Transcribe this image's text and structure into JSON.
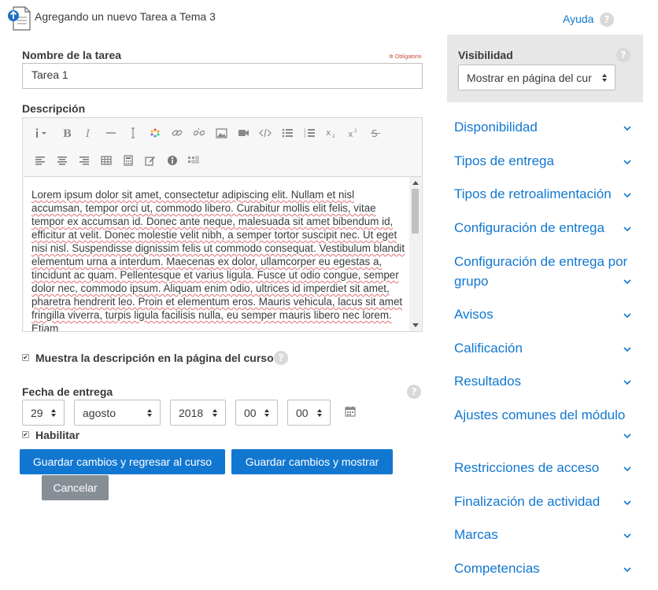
{
  "header": {
    "title": "Agregando un nuevo Tarea a Tema 3",
    "help_label": "Ayuda",
    "help_icon": "?"
  },
  "form": {
    "name_label": "Nombre de la tarea",
    "required_note": "✲ Obligatorio",
    "name_value": "Tarea 1",
    "description_label": "Descripción",
    "description_text": "Lorem ipsum dolor sit amet, consectetur adipiscing elit. Nullam et nisl accumsan, tempor orci ut, commodo libero. Curabitur mollis elit felis, vitae tempor ex accumsan id. Donec ante neque, malesuada sit amet bibendum id, efficitur at velit. Donec molestie velit nibh, a semper tortor suscipit nec. Ut eget nisi nisl. Suspendisse dignissim felis ut commodo consequat. Vestibulum blandit elementum urna a interdum. Maecenas ex dolor, ullamcorper eu egestas a, tincidunt ac quam. Pellentesque et varius ligula. Fusce ut odio congue, semper dolor nec, commodo ipsum. Aliquam enim odio, ultrices id imperdiet sit amet, pharetra hendrerit leo. Proin et elementum eros. Mauris vehicula, lacus sit amet fringilla viverra, turpis ligula facilisis nulla, eu semper mauris libero nec lorem. Etiam",
    "show_description_label": "Muestra la descripción en la página del curso",
    "show_description_checked": true,
    "due_date_label": "Fecha de entrega",
    "due_day": "29",
    "due_month": "agosto",
    "due_year": "2018",
    "due_hour": "00",
    "due_minute": "00",
    "enable_label": "Habilitar",
    "enable_checked": true
  },
  "toolbar": {
    "row1": [
      "info-menu-icon",
      "bold-icon",
      "italic-icon",
      "horizontal-rule-icon",
      "text-cursor-icon",
      "color-picker-icon",
      "link-icon",
      "unlink-icon",
      "image-icon",
      "video-icon",
      "html-code-icon",
      "unordered-list-icon",
      "ordered-list-icon",
      "subscript-icon",
      "superscript-icon",
      "strikethrough-icon"
    ],
    "row2": [
      "align-left-icon",
      "align-center-icon",
      "align-right-icon",
      "table-icon",
      "calculator-icon",
      "edit-icon",
      "accessibility-icon",
      "special-chars-icon"
    ]
  },
  "buttons": {
    "save_return": "Guardar cambios y regresar al curso",
    "save_display": "Guardar cambios y mostrar",
    "cancel": "Cancelar"
  },
  "sidebar": {
    "visibility_label": "Visibilidad",
    "visibility_value": "Mostrar en página del cur",
    "sections": [
      "Disponibilidad",
      "Tipos de entrega",
      "Tipos de retroalimentación",
      "Configuración de entrega",
      "Configuración de entrega por grupo",
      "Avisos",
      "Calificación",
      "Resultados",
      "Ajustes comunes del módulo",
      "Restricciones de acceso",
      "Finalización de actividad",
      "Marcas",
      "Competencias"
    ]
  },
  "colors": {
    "link": "#1177d1",
    "primary_button": "#1177d1",
    "secondary_button": "#868e96",
    "panel_bg": "#e7e7e7",
    "required": "#c44d39"
  }
}
